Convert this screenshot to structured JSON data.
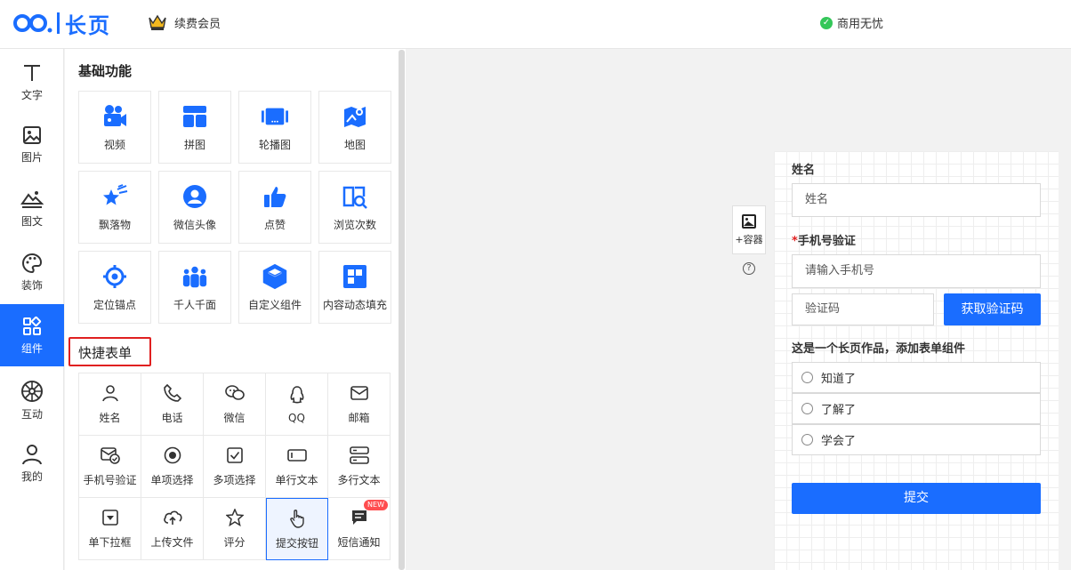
{
  "header": {
    "logo_text": "长页",
    "renew_label": "续费会员",
    "commercial_label": "商用无忧"
  },
  "rail": {
    "items": [
      {
        "label": "文字",
        "icon": "text-icon"
      },
      {
        "label": "图片",
        "icon": "image-icon"
      },
      {
        "label": "图文",
        "icon": "image-text-icon"
      },
      {
        "label": "装饰",
        "icon": "palette-icon"
      },
      {
        "label": "组件",
        "icon": "components-icon",
        "active": true
      },
      {
        "label": "互动",
        "icon": "wheel-icon"
      },
      {
        "label": "我的",
        "icon": "user-icon"
      }
    ]
  },
  "panel": {
    "basic_title": "基础功能",
    "basic_items": [
      {
        "label": "视频",
        "icon": "video-icon"
      },
      {
        "label": "拼图",
        "icon": "puzzle-layout-icon"
      },
      {
        "label": "轮播图",
        "icon": "carousel-icon"
      },
      {
        "label": "地图",
        "icon": "map-icon"
      },
      {
        "label": "飘落物",
        "icon": "falling-star-icon"
      },
      {
        "label": "微信头像",
        "icon": "wechat-avatar-icon"
      },
      {
        "label": "点赞",
        "icon": "thumbs-up-icon"
      },
      {
        "label": "浏览次数",
        "icon": "views-count-icon"
      },
      {
        "label": "定位锚点",
        "icon": "anchor-target-icon"
      },
      {
        "label": "千人千面",
        "icon": "crowd-icon"
      },
      {
        "label": "自定义组件",
        "icon": "custom-cube-icon"
      },
      {
        "label": "内容动态填充",
        "icon": "dynamic-fill-icon"
      }
    ],
    "form_title": "快捷表单",
    "form_items": [
      {
        "label": "姓名",
        "icon": "person-icon"
      },
      {
        "label": "电话",
        "icon": "phone-icon"
      },
      {
        "label": "微信",
        "icon": "wechat-icon"
      },
      {
        "label": "QQ",
        "icon": "qq-icon"
      },
      {
        "label": "邮箱",
        "icon": "mail-icon"
      },
      {
        "label": "手机号验证",
        "icon": "mail-check-icon"
      },
      {
        "label": "单项选择",
        "icon": "radio-icon"
      },
      {
        "label": "多项选择",
        "icon": "checkbox-icon"
      },
      {
        "label": "单行文本",
        "icon": "single-line-icon"
      },
      {
        "label": "多行文本",
        "icon": "multi-line-icon"
      },
      {
        "label": "单下拉框",
        "icon": "dropdown-icon"
      },
      {
        "label": "上传文件",
        "icon": "upload-icon"
      },
      {
        "label": "评分",
        "icon": "star-icon"
      },
      {
        "label": "提交按钮",
        "icon": "pointer-hand-icon",
        "selected": true
      },
      {
        "label": "短信通知",
        "icon": "sms-icon",
        "badge": "NEW"
      }
    ]
  },
  "canvas": {
    "container_label": "+容器",
    "help_glyph": "?",
    "form": {
      "name_label": "姓名",
      "name_placeholder": "姓名",
      "phone_label": "手机号验证",
      "phone_required": "*",
      "phone_placeholder": "请输入手机号",
      "code_placeholder": "验证码",
      "code_button": "获取验证码",
      "question": "这是一个长页作品，添加表单组件",
      "options": [
        "知道了",
        "了解了",
        "学会了"
      ],
      "submit_label": "提交"
    }
  },
  "colors": {
    "accent": "#1a6dff",
    "highlight": "#e02020",
    "ok": "#34c759"
  }
}
